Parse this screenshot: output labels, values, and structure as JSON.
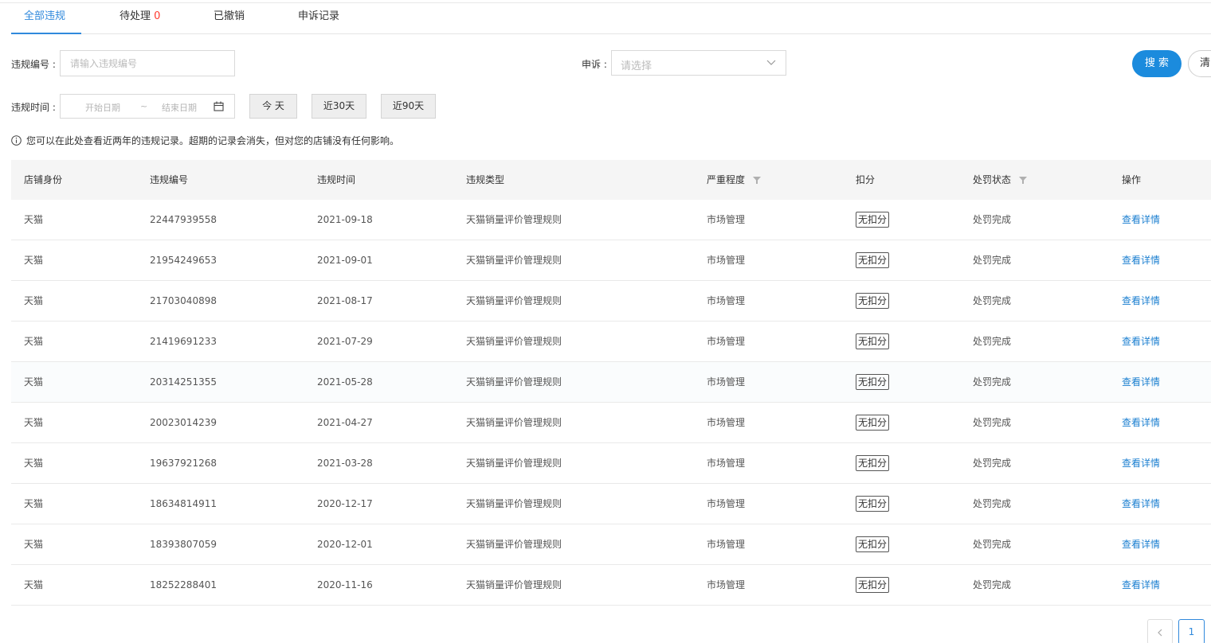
{
  "tabs": [
    {
      "label": "全部违规",
      "count": ""
    },
    {
      "label": "待处理",
      "count": "0"
    },
    {
      "label": "已撤销",
      "count": ""
    },
    {
      "label": "申诉记录",
      "count": ""
    }
  ],
  "filters": {
    "violation_no_label": "违规编号 :",
    "violation_no_placeholder": "请输入违规编号",
    "appeal_label": "申诉 :",
    "appeal_placeholder": "请选择",
    "search_label": "搜 索",
    "clear_label": "清",
    "time_label": "违规时间 :",
    "start_placeholder": "开始日期",
    "range_sep": "~",
    "end_placeholder": "结束日期",
    "quick_today": "今 天",
    "quick_30": "近30天",
    "quick_90": "近90天"
  },
  "notice": "您可以在此处查看近两年的违规记录。超期的记录会消失，但对您的店铺没有任何影响。",
  "table": {
    "headers": {
      "shop": "店铺身份",
      "no": "违规编号",
      "time": "违规时间",
      "type": "违规类型",
      "severity": "严重程度",
      "points": "扣分",
      "status": "处罚状态",
      "action": "操作"
    },
    "rows": [
      {
        "shop": "天猫",
        "no": "22447939558",
        "time": "2021-09-18",
        "type": "天猫销量评价管理规则",
        "severity": "市场管理",
        "points": "无扣分",
        "status": "处罚完成",
        "action": "查看详情"
      },
      {
        "shop": "天猫",
        "no": "21954249653",
        "time": "2021-09-01",
        "type": "天猫销量评价管理规则",
        "severity": "市场管理",
        "points": "无扣分",
        "status": "处罚完成",
        "action": "查看详情"
      },
      {
        "shop": "天猫",
        "no": "21703040898",
        "time": "2021-08-17",
        "type": "天猫销量评价管理规则",
        "severity": "市场管理",
        "points": "无扣分",
        "status": "处罚完成",
        "action": "查看详情"
      },
      {
        "shop": "天猫",
        "no": "21419691233",
        "time": "2021-07-29",
        "type": "天猫销量评价管理规则",
        "severity": "市场管理",
        "points": "无扣分",
        "status": "处罚完成",
        "action": "查看详情"
      },
      {
        "shop": "天猫",
        "no": "20314251355",
        "time": "2021-05-28",
        "type": "天猫销量评价管理规则",
        "severity": "市场管理",
        "points": "无扣分",
        "status": "处罚完成",
        "action": "查看详情"
      },
      {
        "shop": "天猫",
        "no": "20023014239",
        "time": "2021-04-27",
        "type": "天猫销量评价管理规则",
        "severity": "市场管理",
        "points": "无扣分",
        "status": "处罚完成",
        "action": "查看详情"
      },
      {
        "shop": "天猫",
        "no": "19637921268",
        "time": "2021-03-28",
        "type": "天猫销量评价管理规则",
        "severity": "市场管理",
        "points": "无扣分",
        "status": "处罚完成",
        "action": "查看详情"
      },
      {
        "shop": "天猫",
        "no": "18634814911",
        "time": "2020-12-17",
        "type": "天猫销量评价管理规则",
        "severity": "市场管理",
        "points": "无扣分",
        "status": "处罚完成",
        "action": "查看详情"
      },
      {
        "shop": "天猫",
        "no": "18393807059",
        "time": "2020-12-01",
        "type": "天猫销量评价管理规则",
        "severity": "市场管理",
        "points": "无扣分",
        "status": "处罚完成",
        "action": "查看详情"
      },
      {
        "shop": "天猫",
        "no": "18252288401",
        "time": "2020-11-16",
        "type": "天猫销量评价管理规则",
        "severity": "市场管理",
        "points": "无扣分",
        "status": "处罚完成",
        "action": "查看详情"
      }
    ]
  },
  "pagination": {
    "current": "1"
  },
  "icons": {
    "calendar": "calendar-icon",
    "info": "info-icon",
    "filter": "filter-icon",
    "chevron": "chevron-down-icon",
    "prev": "chevron-left-icon"
  },
  "colors": {
    "accent": "#3089dc",
    "search_button": "#1b8bdd",
    "count_red": "#ff3b30",
    "link": "#1b7fd0"
  }
}
